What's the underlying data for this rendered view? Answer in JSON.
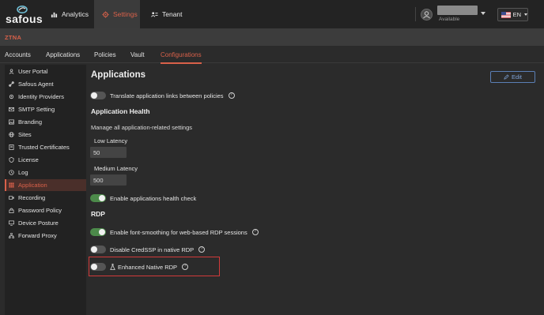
{
  "brand": {
    "name": "safous"
  },
  "nav": {
    "items": [
      {
        "label": "Analytics",
        "icon": "analytics-icon"
      },
      {
        "label": "Settings",
        "icon": "gear-icon",
        "active": true
      },
      {
        "label": "Tenant",
        "icon": "tenant-icon"
      }
    ]
  },
  "user": {
    "status": "Available"
  },
  "language": {
    "code": "EN",
    "flag": "us-flag-icon"
  },
  "context": {
    "label": "ZTNA"
  },
  "tabs": [
    {
      "label": "Accounts"
    },
    {
      "label": "Applications"
    },
    {
      "label": "Policies"
    },
    {
      "label": "Vault"
    },
    {
      "label": "Configurations",
      "active": true
    }
  ],
  "sidebar": {
    "items": [
      {
        "label": "User Portal",
        "icon": "user-icon"
      },
      {
        "label": "Safous Agent",
        "icon": "link-icon"
      },
      {
        "label": "Identity Providers",
        "icon": "gear-icon"
      },
      {
        "label": "SMTP Setting",
        "icon": "mail-icon"
      },
      {
        "label": "Branding",
        "icon": "image-icon"
      },
      {
        "label": "Sites",
        "icon": "globe-icon"
      },
      {
        "label": "Trusted Certificates",
        "icon": "certificate-icon"
      },
      {
        "label": "License",
        "icon": "shield-icon"
      },
      {
        "label": "Log",
        "icon": "clock-icon"
      },
      {
        "label": "Application",
        "icon": "grid-icon",
        "active": true
      },
      {
        "label": "Recording",
        "icon": "video-icon"
      },
      {
        "label": "Password Policy",
        "icon": "lock-icon"
      },
      {
        "label": "Device Posture",
        "icon": "monitor-icon"
      },
      {
        "label": "Forward Proxy",
        "icon": "network-icon"
      }
    ]
  },
  "main": {
    "title": "Applications",
    "edit_label": "Edit",
    "translate_links": {
      "label": "Translate application links between policies",
      "enabled": false
    },
    "health": {
      "heading": "Application Health",
      "description": "Manage all application-related settings",
      "low_latency": {
        "label": "Low Latency",
        "value": "50"
      },
      "medium_latency": {
        "label": "Medium Latency",
        "value": "500"
      },
      "check": {
        "label": "Enable applications health check",
        "enabled": true
      }
    },
    "rdp": {
      "heading": "RDP",
      "font_smoothing": {
        "label": "Enable font-smoothing for web-based RDP sessions",
        "enabled": true
      },
      "credssp": {
        "label": "Disable CredSSP in native RDP",
        "enabled": false
      },
      "enhanced": {
        "label": "Enhanced Native RDP",
        "enabled": false
      }
    }
  },
  "colors": {
    "accent": "#d9614a",
    "toggle_on": "#4c8a4a",
    "edit_blue": "#7fa3d8",
    "highlight": "#d23a3a"
  }
}
